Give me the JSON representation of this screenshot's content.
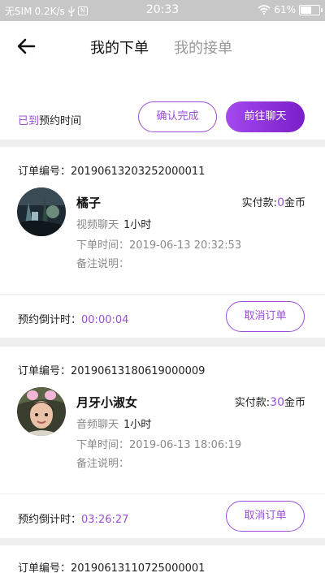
{
  "status_bar": {
    "carrier": "无SIM",
    "speed": "0.2K/s",
    "usb_icon": "usb-icon",
    "volume_badge": "N",
    "time": "20:33",
    "wifi_icon": "wifi-icon",
    "battery_percent": "61%",
    "battery_level": 0.61
  },
  "header": {
    "back_icon": "back-arrow-icon",
    "tabs": [
      {
        "label": "我的下单",
        "active": true
      },
      {
        "label": "我的接单",
        "active": false
      }
    ]
  },
  "top_bar": {
    "status_highlight": "已到",
    "status_rest": "预约时间",
    "confirm_label": "确认完成",
    "chat_label": "前往聊天"
  },
  "orders": [
    {
      "order_label": "订单编号：",
      "order_no": "20190613203252000011",
      "name": "橘子",
      "pay_label": "实付款:",
      "pay_amount": "0",
      "pay_unit": "金币",
      "service": "视频聊天",
      "duration": "1小时",
      "order_time_label": "下单时间：",
      "order_time": "2019-06-13 20:32:53",
      "note_label": "备注说明：",
      "countdown_label": "预约倒计时：",
      "countdown": "00:00:04",
      "cancel_label": "取消订单"
    },
    {
      "order_label": "订单编号：",
      "order_no": "20190613180619000009",
      "name": "月牙小淑女",
      "pay_label": "实付款:",
      "pay_amount": "30",
      "pay_unit": "金币",
      "service": "音频聊天",
      "duration": "1小时",
      "order_time_label": "下单时间：",
      "order_time": "2019-06-13 18:06:19",
      "note_label": "备注说明：",
      "countdown_label": "预约倒计时：",
      "countdown": "03:26:27",
      "cancel_label": "取消订单"
    },
    {
      "order_label": "订单编号：",
      "order_no": "20190613110725000001"
    }
  ],
  "colors": {
    "accent": "#9b4fd9",
    "status_bar": "#c7c7c7",
    "background": "#efefef"
  }
}
